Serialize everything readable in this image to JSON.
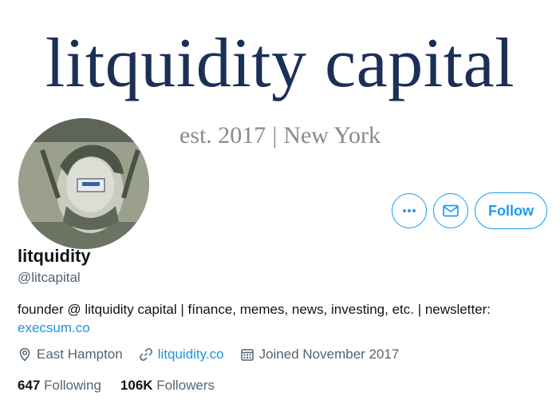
{
  "banner": {
    "title": "litquidity capital",
    "est": "est. 2017",
    "separator": "|",
    "location": "New York"
  },
  "profile": {
    "display_name": "litquidity",
    "handle": "@litcapital",
    "bio_text": "founder @ litquidity capital | fínance, memes, news, investing, etc. | newsletter:",
    "bio_link": "execsum.co"
  },
  "actions": {
    "more_icon": "more-horizontal-icon",
    "message_icon": "mail-icon",
    "follow_label": "Follow"
  },
  "meta": {
    "location_icon": "location-pin-icon",
    "location": "East Hampton",
    "link_icon": "link-icon",
    "website": "litquidity.co",
    "calendar_icon": "calendar-icon",
    "joined": "Joined November 2017"
  },
  "stats": {
    "following_count": "647",
    "following_label": "Following",
    "followers_count": "106K",
    "followers_label": "Followers"
  },
  "colors": {
    "accent": "#1d9bf0",
    "banner_title": "#1c2f57",
    "banner_sub": "#8a8a8a",
    "secondary_text": "#536471"
  }
}
